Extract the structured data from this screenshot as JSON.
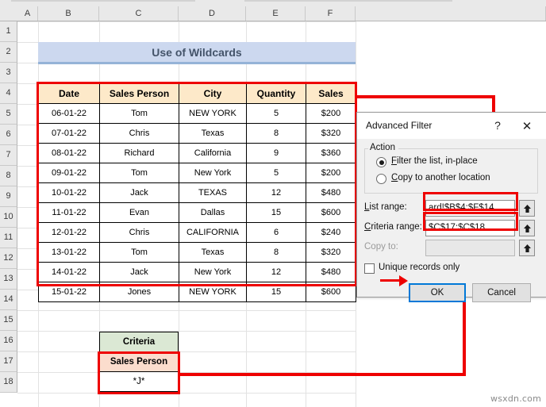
{
  "sheet": {
    "column_headers": [
      "A",
      "B",
      "C",
      "D",
      "E",
      "F"
    ],
    "row_headers": [
      "1",
      "2",
      "3",
      "4",
      "5",
      "6",
      "7",
      "8",
      "9",
      "10",
      "11",
      "12",
      "13",
      "14",
      "15",
      "16",
      "17",
      "18"
    ],
    "banner_title": "Use of Wildcards",
    "banner_color": "#ccd8ef"
  },
  "data_table": {
    "headers": [
      "Date",
      "Sales Person",
      "City",
      "Quantity",
      "Sales"
    ],
    "header_fill": "#fde9c9",
    "rows": [
      [
        "06-01-22",
        "Tom",
        "NEW YORK",
        "5",
        "$200"
      ],
      [
        "07-01-22",
        "Chris",
        "Texas",
        "8",
        "$320"
      ],
      [
        "08-01-22",
        "Richard",
        "California",
        "9",
        "$360"
      ],
      [
        "09-01-22",
        "Tom",
        "New York",
        "5",
        "$200"
      ],
      [
        "10-01-22",
        "Jack",
        "TEXAS",
        "12",
        "$480"
      ],
      [
        "11-01-22",
        "Evan",
        "Dallas",
        "15",
        "$600"
      ],
      [
        "12-01-22",
        "Chris",
        "CALIFORNIA",
        "6",
        "$240"
      ],
      [
        "13-01-22",
        "Tom",
        "Texas",
        "8",
        "$320"
      ],
      [
        "14-01-22",
        "Jack",
        "New York",
        "12",
        "$480"
      ],
      [
        "15-01-22",
        "Jones",
        "NEW YORK",
        "15",
        "$600"
      ]
    ]
  },
  "criteria_table": {
    "title": "Criteria",
    "field": "Sales Person",
    "value": "*J*",
    "title_fill": "#dbe8d4",
    "field_fill": "#fbddcd"
  },
  "dialog": {
    "title": "Advanced Filter",
    "help_icon": "?",
    "close_icon": "✕",
    "action_group_label": "Action",
    "radio_filter_inplace": "Filter the list, in-place",
    "radio_filter_inplace_selected": true,
    "radio_copy_another": "Copy to another location",
    "radio_copy_another_selected": false,
    "list_range_label": "List range:",
    "list_range_value": "ard!$B$4:$F$14",
    "criteria_range_label": "Criteria range:",
    "criteria_range_value": "$C$17:$C$18",
    "copy_to_label": "Copy to:",
    "copy_to_value": "",
    "copy_to_disabled": true,
    "unique_records_label": "Unique records only",
    "unique_records_checked": false,
    "ok_label": "OK",
    "cancel_label": "Cancel",
    "collapse_icon": "range-picker-icon"
  },
  "annotations": {
    "highlight_color": "#ee0000",
    "focus_color": "#0078d7"
  },
  "watermark": "wsxdn.com"
}
